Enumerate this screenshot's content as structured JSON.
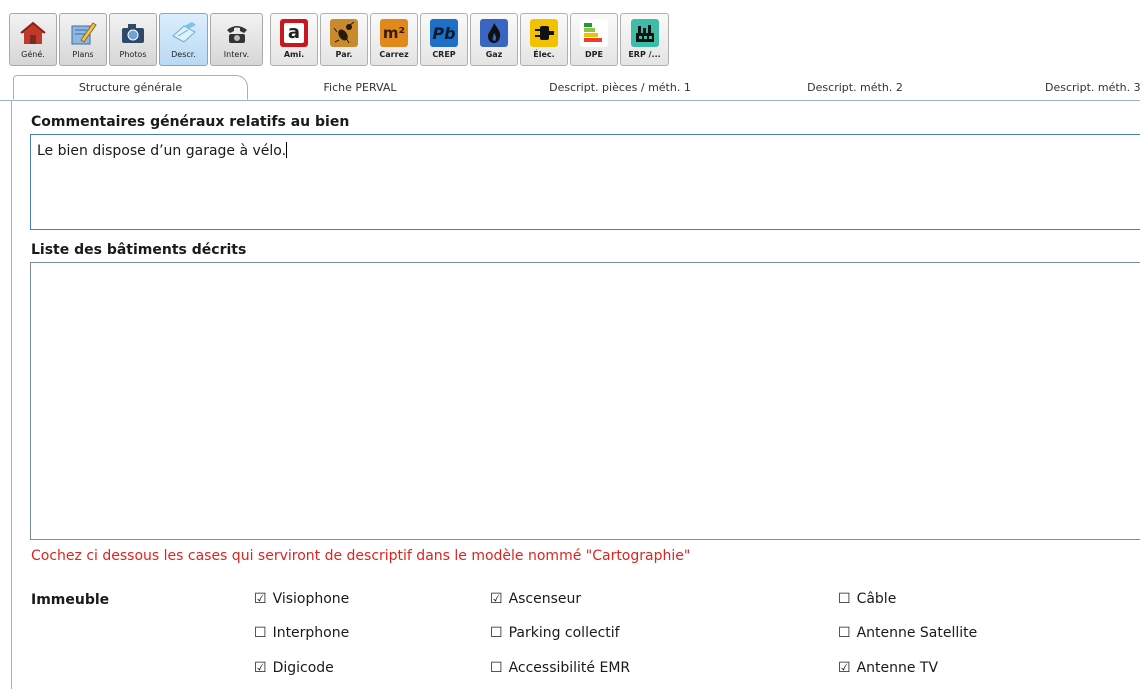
{
  "toolbar": {
    "buttons": [
      {
        "label": "Géné.",
        "icon": "house-icon"
      },
      {
        "label": "Plans",
        "icon": "pencil-plan-icon"
      },
      {
        "label": "Photos",
        "icon": "camera-icon"
      },
      {
        "label": "Descr.",
        "icon": "description-icon",
        "active": true
      },
      {
        "label": "Interv.",
        "icon": "telephone-icon"
      },
      {
        "label": "Ami.",
        "icon": "asbestos-a-icon"
      },
      {
        "label": "Par.",
        "icon": "termite-icon"
      },
      {
        "label": "Carrez",
        "icon": "m2-icon"
      },
      {
        "label": "CREP",
        "icon": "lead-pb-icon"
      },
      {
        "label": "Gaz",
        "icon": "gas-flame-icon"
      },
      {
        "label": "Élec.",
        "icon": "electric-plug-icon"
      },
      {
        "label": "DPE",
        "icon": "energy-label-icon"
      },
      {
        "label": "ERP /...",
        "icon": "factory-icon"
      }
    ],
    "icon_glyphs": {
      "asbestos": "a",
      "carrez": "m²",
      "crep": "Pb"
    }
  },
  "tabs": [
    {
      "label": "Structure générale",
      "active": true
    },
    {
      "label": "Fiche PERVAL"
    },
    {
      "label": "Descript. pièces / méth. 1"
    },
    {
      "label": "Descript. méth. 2"
    },
    {
      "label": "Descript. méth. 3"
    }
  ],
  "comments": {
    "heading": "Commentaires généraux relatifs au bien",
    "value": "Le bien dispose d’un garage à vélo."
  },
  "buildings": {
    "heading": "Liste des bâtiments décrits"
  },
  "warning": "Cochez ci dessous les cases qui serviront de descriptif dans le modèle nommé \"Cartographie\"",
  "immeuble": {
    "label": "Immeuble",
    "checkboxes": [
      {
        "label": "Visiophone",
        "checked": true,
        "glyph": "☑"
      },
      {
        "label": "Ascenseur",
        "checked": true,
        "glyph": "☑"
      },
      {
        "label": "Câble",
        "checked": false,
        "glyph": "☐"
      },
      {
        "label": "Interphone",
        "checked": false,
        "glyph": "☐"
      },
      {
        "label": "Parking collectif",
        "checked": false,
        "glyph": "☐"
      },
      {
        "label": "Antenne Satellite",
        "checked": false,
        "glyph": "☐"
      },
      {
        "label": "Digicode",
        "checked": true,
        "glyph": "☑"
      },
      {
        "label": "Accessibilité EMR",
        "checked": false,
        "glyph": "☐"
      },
      {
        "label": "Antenne TV",
        "checked": true,
        "glyph": "☑"
      }
    ]
  },
  "colors": {
    "warning": "#e0221e",
    "accent_border": "#4a7fb5"
  }
}
